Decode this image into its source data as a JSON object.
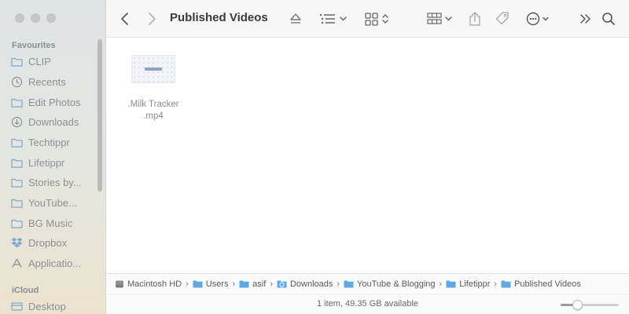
{
  "window": {
    "title": "Published Videos"
  },
  "sidebar": {
    "favourites_label": "Favourites",
    "items": [
      {
        "label": "CLIP",
        "icon": "folder-icon"
      },
      {
        "label": "Recents",
        "icon": "clock-icon"
      },
      {
        "label": "Edit Photos",
        "icon": "folder-icon"
      },
      {
        "label": "Downloads",
        "icon": "download-icon"
      },
      {
        "label": "Techtippr",
        "icon": "folder-icon"
      },
      {
        "label": "Lifetippr",
        "icon": "folder-icon"
      },
      {
        "label": "Stories by...",
        "icon": "folder-icon"
      },
      {
        "label": "YouTube...",
        "icon": "folder-icon"
      },
      {
        "label": "BG Music",
        "icon": "folder-icon"
      },
      {
        "label": "Dropbox",
        "icon": "dropbox-icon"
      },
      {
        "label": "Applicatio...",
        "icon": "applications-icon"
      }
    ],
    "icloud_label": "iCloud",
    "icloud_items": [
      {
        "label": "Desktop",
        "icon": "desktop-icon"
      }
    ]
  },
  "toolbar": {
    "back": "back-chevron-icon",
    "forward": "forward-chevron-icon",
    "eject": "eject-icon",
    "list_view": "list-view-icon",
    "grid_view": "grid-view-icon",
    "group": "group-icon",
    "share": "share-icon",
    "tag": "tag-icon",
    "more": "more-icon",
    "overflow": "double-chevron-icon",
    "search": "search-icon"
  },
  "content": {
    "files": [
      {
        "name": ".Milk Tracker .mp4"
      }
    ]
  },
  "pathbar": {
    "crumbs": [
      {
        "label": "Macintosh HD",
        "icon": "disk-icon"
      },
      {
        "label": "Users",
        "icon": "folder-icon"
      },
      {
        "label": "asif",
        "icon": "folder-icon"
      },
      {
        "label": "Downloads",
        "icon": "download-folder-icon"
      },
      {
        "label": "YouTube & Blogging",
        "icon": "folder-icon"
      },
      {
        "label": "Lifetippr",
        "icon": "folder-icon"
      },
      {
        "label": "Published Videos",
        "icon": "folder-icon"
      }
    ]
  },
  "status": {
    "text": "1 item, 49.35 GB available",
    "icon_size_level": 0.25
  },
  "colors": {
    "folder": "#79a7d6",
    "sidebar_text": "#8b9196",
    "accent_folder": "#5fa8e6"
  }
}
